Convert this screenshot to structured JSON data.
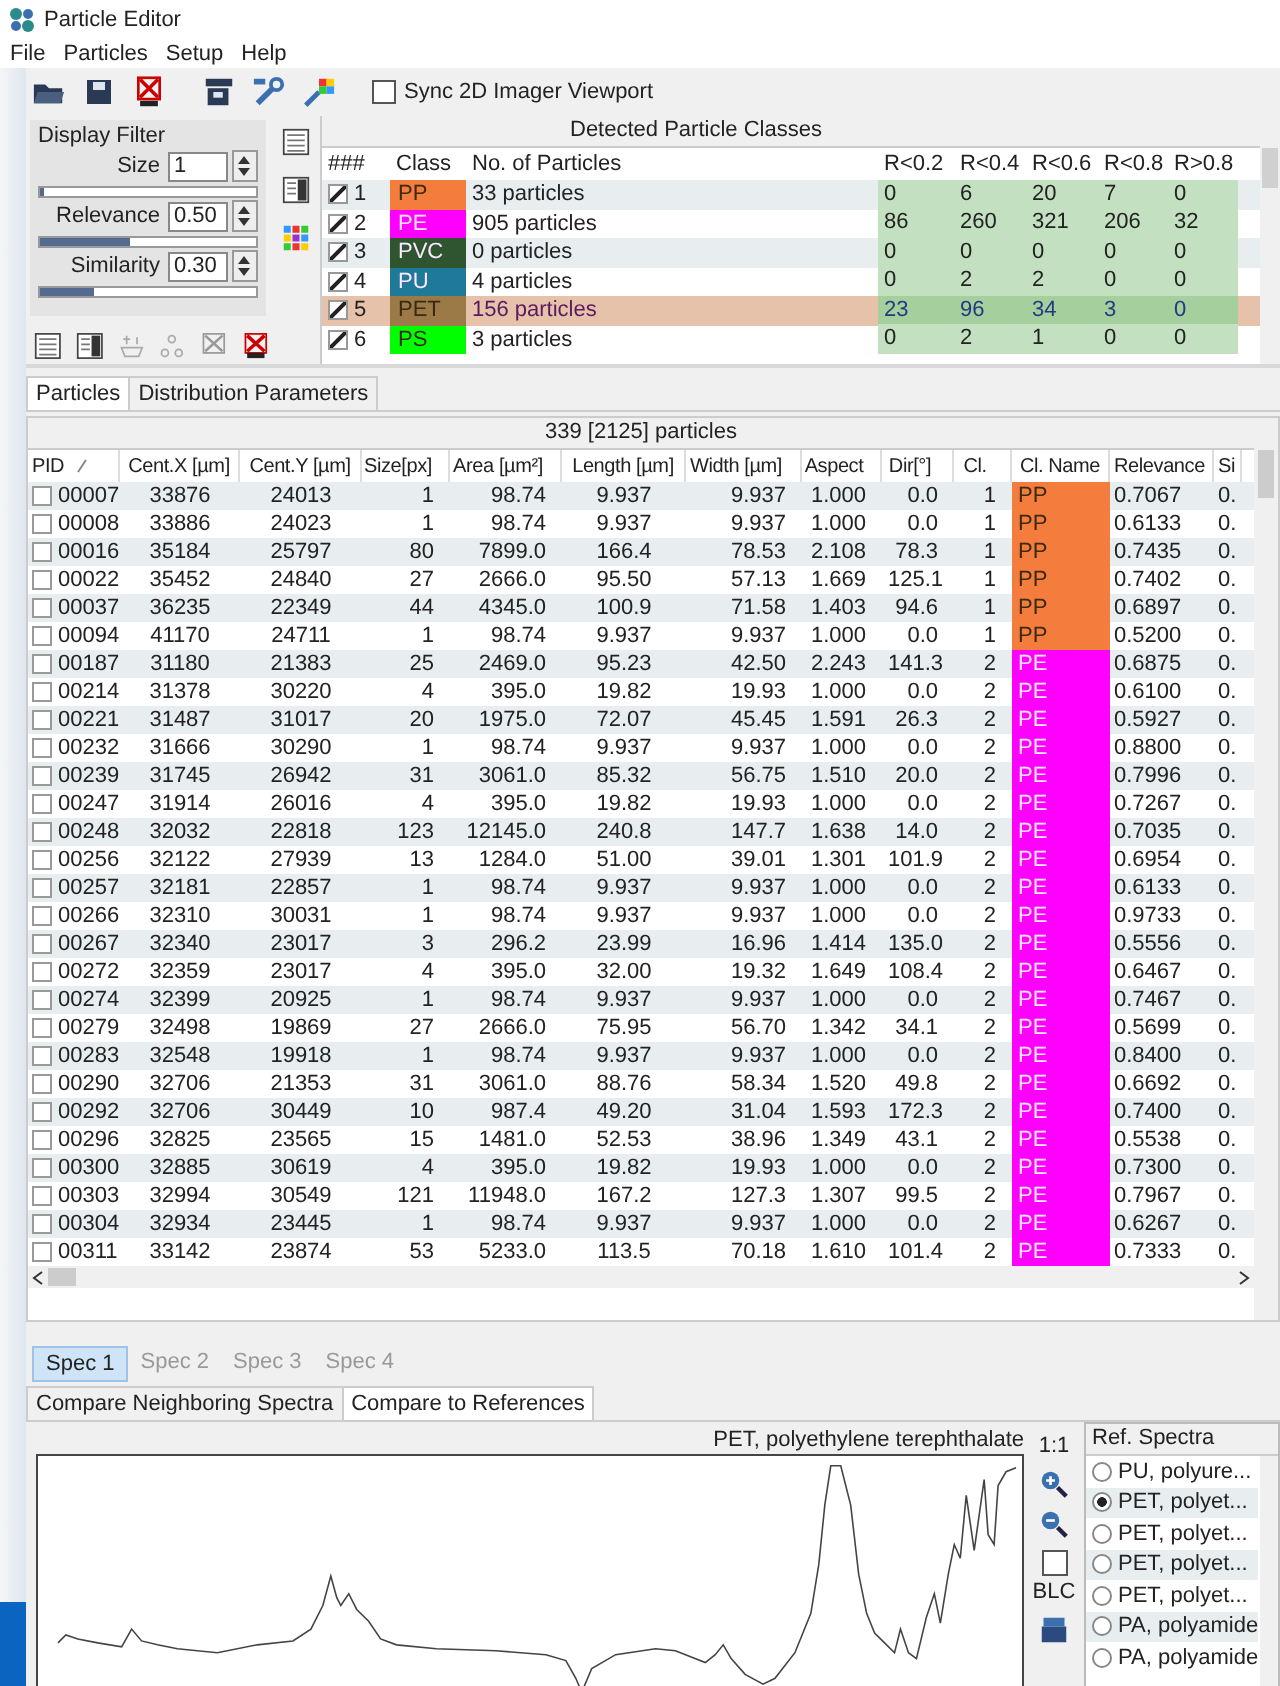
{
  "window": {
    "title": "Particle Editor"
  },
  "menu": [
    "File",
    "Particles",
    "Setup",
    "Help"
  ],
  "toolbar": {
    "sync": {
      "label": "Sync 2D Imager Viewport",
      "checked": false
    }
  },
  "filter": {
    "title": "Display Filter",
    "controls": [
      {
        "label": "Size",
        "value": "1",
        "level": 0.02
      },
      {
        "label": "Relevance",
        "value": "0.50",
        "level": 0.42
      },
      {
        "label": "Similarity",
        "value": "0.30",
        "level": 0.25
      }
    ]
  },
  "classes": {
    "title": "Detected Particle Classes",
    "columns": [
      "###",
      "Class",
      "No. of Particles",
      "R<0.2",
      "R<0.4",
      "R<0.6",
      "R<0.8",
      "R>0.8"
    ],
    "rows": [
      {
        "num": "1",
        "checked": true,
        "selected": false,
        "name": "PP",
        "color": "#f47c3c",
        "count": "33 particles",
        "bins": [
          "0",
          "6",
          "20",
          "7",
          "0"
        ]
      },
      {
        "num": "2",
        "checked": true,
        "selected": false,
        "name": "PE",
        "color": "#ff00ff",
        "count": "905 particles",
        "bins": [
          "86",
          "260",
          "321",
          "206",
          "32"
        ]
      },
      {
        "num": "3",
        "checked": true,
        "selected": false,
        "name": "PVC",
        "color": "#2f5530",
        "count": "0 particles",
        "bins": [
          "0",
          "0",
          "0",
          "0",
          "0"
        ]
      },
      {
        "num": "4",
        "checked": true,
        "selected": false,
        "name": "PU",
        "color": "#1f7a9a",
        "count": "4 particles",
        "bins": [
          "0",
          "2",
          "2",
          "0",
          "0"
        ]
      },
      {
        "num": "5",
        "checked": true,
        "selected": true,
        "name": "PET",
        "color": "#9c7a48",
        "count": "156 particles",
        "bins": [
          "23",
          "96",
          "34",
          "3",
          "0"
        ]
      },
      {
        "num": "6",
        "checked": true,
        "selected": false,
        "name": "PS",
        "color": "#00ff00",
        "count": "3 particles",
        "bins": [
          "0",
          "2",
          "1",
          "0",
          "0"
        ]
      }
    ]
  },
  "tabs": [
    {
      "label": "Particles",
      "selected": true
    },
    {
      "label": "Distribution Parameters",
      "selected": false
    }
  ],
  "table": {
    "caption": "339 [2125] particles",
    "columns": [
      "PID",
      "Cent.X [µm]",
      "Cent.Y [µm]",
      "Size[px]",
      "Area [µm²]",
      "Length [µm]",
      "Width [µm]",
      "Aspect",
      "Dir[°]",
      "Cl.",
      "Cl. Name",
      "Relevance",
      "Si"
    ],
    "rows": [
      {
        "checked": false,
        "color": "#f47c3c",
        "cells": [
          "00007",
          "33876",
          "24013",
          "1",
          "98.74",
          "9.937",
          "9.937",
          "1.000",
          "0.0",
          "1",
          "PP",
          "0.7067",
          "0."
        ]
      },
      {
        "checked": false,
        "color": "#f47c3c",
        "cells": [
          "00008",
          "33886",
          "24023",
          "1",
          "98.74",
          "9.937",
          "9.937",
          "1.000",
          "0.0",
          "1",
          "PP",
          "0.6133",
          "0."
        ]
      },
      {
        "checked": false,
        "color": "#f47c3c",
        "cells": [
          "00016",
          "35184",
          "25797",
          "80",
          "7899.0",
          "166.4",
          "78.53",
          "2.108",
          "78.3",
          "1",
          "PP",
          "0.7435",
          "0."
        ]
      },
      {
        "checked": false,
        "color": "#f47c3c",
        "cells": [
          "00022",
          "35452",
          "24840",
          "27",
          "2666.0",
          "95.50",
          "57.13",
          "1.669",
          "125.1",
          "1",
          "PP",
          "0.7402",
          "0."
        ]
      },
      {
        "checked": false,
        "color": "#f47c3c",
        "cells": [
          "00037",
          "36235",
          "22349",
          "44",
          "4345.0",
          "100.9",
          "71.58",
          "1.403",
          "94.6",
          "1",
          "PP",
          "0.6897",
          "0."
        ]
      },
      {
        "checked": false,
        "color": "#f47c3c",
        "cells": [
          "00094",
          "41170",
          "24711",
          "1",
          "98.74",
          "9.937",
          "9.937",
          "1.000",
          "0.0",
          "1",
          "PP",
          "0.5200",
          "0."
        ]
      },
      {
        "checked": false,
        "color": "#ff00ff",
        "cells": [
          "00187",
          "31180",
          "21383",
          "25",
          "2469.0",
          "95.23",
          "42.50",
          "2.243",
          "141.3",
          "2",
          "PE",
          "0.6875",
          "0."
        ]
      },
      {
        "checked": false,
        "color": "#ff00ff",
        "cells": [
          "00214",
          "31378",
          "30220",
          "4",
          "395.0",
          "19.82",
          "19.93",
          "1.000",
          "0.0",
          "2",
          "PE",
          "0.6100",
          "0."
        ]
      },
      {
        "checked": false,
        "color": "#ff00ff",
        "cells": [
          "00221",
          "31487",
          "31017",
          "20",
          "1975.0",
          "72.07",
          "45.45",
          "1.591",
          "26.3",
          "2",
          "PE",
          "0.5927",
          "0."
        ]
      },
      {
        "checked": false,
        "color": "#ff00ff",
        "cells": [
          "00232",
          "31666",
          "30290",
          "1",
          "98.74",
          "9.937",
          "9.937",
          "1.000",
          "0.0",
          "2",
          "PE",
          "0.8800",
          "0."
        ]
      },
      {
        "checked": false,
        "color": "#ff00ff",
        "cells": [
          "00239",
          "31745",
          "26942",
          "31",
          "3061.0",
          "85.32",
          "56.75",
          "1.510",
          "20.0",
          "2",
          "PE",
          "0.7996",
          "0."
        ]
      },
      {
        "checked": false,
        "color": "#ff00ff",
        "cells": [
          "00247",
          "31914",
          "26016",
          "4",
          "395.0",
          "19.82",
          "19.93",
          "1.000",
          "0.0",
          "2",
          "PE",
          "0.7267",
          "0."
        ]
      },
      {
        "checked": false,
        "color": "#ff00ff",
        "cells": [
          "00248",
          "32032",
          "22818",
          "123",
          "12145.0",
          "240.8",
          "147.7",
          "1.638",
          "14.0",
          "2",
          "PE",
          "0.7035",
          "0."
        ]
      },
      {
        "checked": false,
        "color": "#ff00ff",
        "cells": [
          "00256",
          "32122",
          "27939",
          "13",
          "1284.0",
          "51.00",
          "39.01",
          "1.301",
          "101.9",
          "2",
          "PE",
          "0.6954",
          "0."
        ]
      },
      {
        "checked": false,
        "color": "#ff00ff",
        "cells": [
          "00257",
          "32181",
          "22857",
          "1",
          "98.74",
          "9.937",
          "9.937",
          "1.000",
          "0.0",
          "2",
          "PE",
          "0.6133",
          "0."
        ]
      },
      {
        "checked": false,
        "color": "#ff00ff",
        "cells": [
          "00266",
          "32310",
          "30031",
          "1",
          "98.74",
          "9.937",
          "9.937",
          "1.000",
          "0.0",
          "2",
          "PE",
          "0.9733",
          "0."
        ]
      },
      {
        "checked": false,
        "color": "#ff00ff",
        "cells": [
          "00267",
          "32340",
          "23017",
          "3",
          "296.2",
          "23.99",
          "16.96",
          "1.414",
          "135.0",
          "2",
          "PE",
          "0.5556",
          "0."
        ]
      },
      {
        "checked": false,
        "color": "#ff00ff",
        "cells": [
          "00272",
          "32359",
          "23017",
          "4",
          "395.0",
          "32.00",
          "19.32",
          "1.649",
          "108.4",
          "2",
          "PE",
          "0.6467",
          "0."
        ]
      },
      {
        "checked": false,
        "color": "#ff00ff",
        "cells": [
          "00274",
          "32399",
          "20925",
          "1",
          "98.74",
          "9.937",
          "9.937",
          "1.000",
          "0.0",
          "2",
          "PE",
          "0.7467",
          "0."
        ]
      },
      {
        "checked": false,
        "color": "#ff00ff",
        "cells": [
          "00279",
          "32498",
          "19869",
          "27",
          "2666.0",
          "75.95",
          "56.70",
          "1.342",
          "34.1",
          "2",
          "PE",
          "0.5699",
          "0."
        ]
      },
      {
        "checked": false,
        "color": "#ff00ff",
        "cells": [
          "00283",
          "32548",
          "19918",
          "1",
          "98.74",
          "9.937",
          "9.937",
          "1.000",
          "0.0",
          "2",
          "PE",
          "0.8400",
          "0."
        ]
      },
      {
        "checked": false,
        "color": "#ff00ff",
        "cells": [
          "00290",
          "32706",
          "21353",
          "31",
          "3061.0",
          "88.76",
          "58.34",
          "1.520",
          "49.8",
          "2",
          "PE",
          "0.6692",
          "0."
        ]
      },
      {
        "checked": false,
        "color": "#ff00ff",
        "cells": [
          "00292",
          "32706",
          "30449",
          "10",
          "987.4",
          "49.20",
          "31.04",
          "1.593",
          "172.3",
          "2",
          "PE",
          "0.7400",
          "0."
        ]
      },
      {
        "checked": false,
        "color": "#ff00ff",
        "cells": [
          "00296",
          "32825",
          "23565",
          "15",
          "1481.0",
          "52.53",
          "38.96",
          "1.349",
          "43.1",
          "2",
          "PE",
          "0.5538",
          "0."
        ]
      },
      {
        "checked": false,
        "color": "#ff00ff",
        "cells": [
          "00300",
          "32885",
          "30619",
          "4",
          "395.0",
          "19.82",
          "19.93",
          "1.000",
          "0.0",
          "2",
          "PE",
          "0.7300",
          "0."
        ]
      },
      {
        "checked": false,
        "color": "#ff00ff",
        "cells": [
          "00303",
          "32994",
          "30549",
          "121",
          "11948.0",
          "167.2",
          "127.3",
          "1.307",
          "99.5",
          "2",
          "PE",
          "0.7967",
          "0."
        ]
      },
      {
        "checked": false,
        "color": "#ff00ff",
        "cells": [
          "00304",
          "32934",
          "23445",
          "1",
          "98.74",
          "9.937",
          "9.937",
          "1.000",
          "0.0",
          "2",
          "PE",
          "0.6267",
          "0."
        ]
      },
      {
        "checked": false,
        "color": "#ff00ff",
        "cells": [
          "00311",
          "33142",
          "23874",
          "53",
          "5233.0",
          "113.5",
          "70.18",
          "1.610",
          "101.4",
          "2",
          "PE",
          "0.7333",
          "0."
        ]
      }
    ]
  },
  "spec_tabs": [
    {
      "label": "Spec 1",
      "selected": true
    },
    {
      "label": "Spec 2",
      "selected": false
    },
    {
      "label": "Spec 3",
      "selected": false
    },
    {
      "label": "Spec 4",
      "selected": false
    }
  ],
  "compare_tabs": [
    {
      "label": "Compare Neighboring Spectra",
      "selected": false
    },
    {
      "label": "Compare to References",
      "selected": true
    }
  ],
  "spectrum": {
    "title": "PET, polyethylene terephthalate",
    "scale": "1:1",
    "blc": {
      "label": "BLC",
      "checked": false
    }
  },
  "references": {
    "title": "Ref. Spectra",
    "items": [
      {
        "label": "PU, polyure...",
        "selected": false
      },
      {
        "label": "PET, polyet...",
        "selected": true
      },
      {
        "label": "PET, polyet...",
        "selected": false
      },
      {
        "label": "PET, polyet...",
        "selected": false
      },
      {
        "label": "PET, polyet...",
        "selected": false
      },
      {
        "label": "PA, polyamide",
        "selected": false
      },
      {
        "label": "PA, polyamide",
        "selected": false
      }
    ]
  }
}
